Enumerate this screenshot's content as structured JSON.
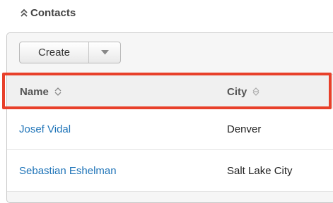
{
  "section": {
    "title": "Contacts",
    "icon": "double-chevron-up-icon"
  },
  "toolbar": {
    "create_label": "Create",
    "dropdown_icon": "caret-down-icon"
  },
  "table": {
    "columns": [
      {
        "label": "Name",
        "sort_icon": "sort-icon"
      },
      {
        "label": "City",
        "sort_icon": "sort-icon"
      }
    ],
    "rows": [
      {
        "name": "Josef Vidal",
        "city": "Denver"
      },
      {
        "name": "Sebastian Eshelman",
        "city": "Salt Lake City"
      }
    ]
  },
  "colors": {
    "link": "#1f74b8",
    "highlight": "#e8402a"
  }
}
